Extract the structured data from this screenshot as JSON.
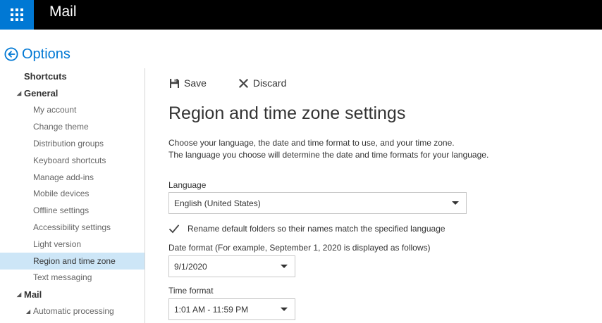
{
  "app": {
    "title": "Mail"
  },
  "options": {
    "title": "Options"
  },
  "nav": {
    "items": [
      {
        "label": "Shortcuts"
      },
      {
        "label": "General"
      },
      {
        "label": "My account"
      },
      {
        "label": "Change theme"
      },
      {
        "label": "Distribution groups"
      },
      {
        "label": "Keyboard shortcuts"
      },
      {
        "label": "Manage add-ins"
      },
      {
        "label": "Mobile devices"
      },
      {
        "label": "Offline settings"
      },
      {
        "label": "Accessibility settings"
      },
      {
        "label": "Light version"
      },
      {
        "label": "Region and time zone"
      },
      {
        "label": "Text messaging"
      },
      {
        "label": "Mail"
      },
      {
        "label": "Automatic processing"
      }
    ],
    "selected": "Region and time zone"
  },
  "toolbar": {
    "save_label": "Save",
    "discard_label": "Discard"
  },
  "page": {
    "title": "Region and time zone settings",
    "description_line1": "Choose your language, the date and time format to use, and your time zone.",
    "description_line2": "The language you choose will determine the date and time formats for your language."
  },
  "language": {
    "label": "Language",
    "value": "English (United States)"
  },
  "rename_folders": {
    "label": "Rename default folders so their names match the specified language",
    "checked": true
  },
  "date_format": {
    "label": "Date format (For example, September 1, 2020 is displayed as follows)",
    "value": "9/1/2020"
  },
  "time_format": {
    "label": "Time format",
    "value": "1:01 AM - 11:59 PM"
  },
  "colors": {
    "accent": "#0078d4",
    "selected_bg": "#cde6f7",
    "topbar": "#000000"
  },
  "icons": {
    "app_launcher": "waffle-icon",
    "back": "back-arrow-circle-icon",
    "save": "floppy-disk-icon",
    "discard": "close-x-icon",
    "checkbox": "checkmark-icon",
    "dropdown": "chevron-down-icon"
  }
}
